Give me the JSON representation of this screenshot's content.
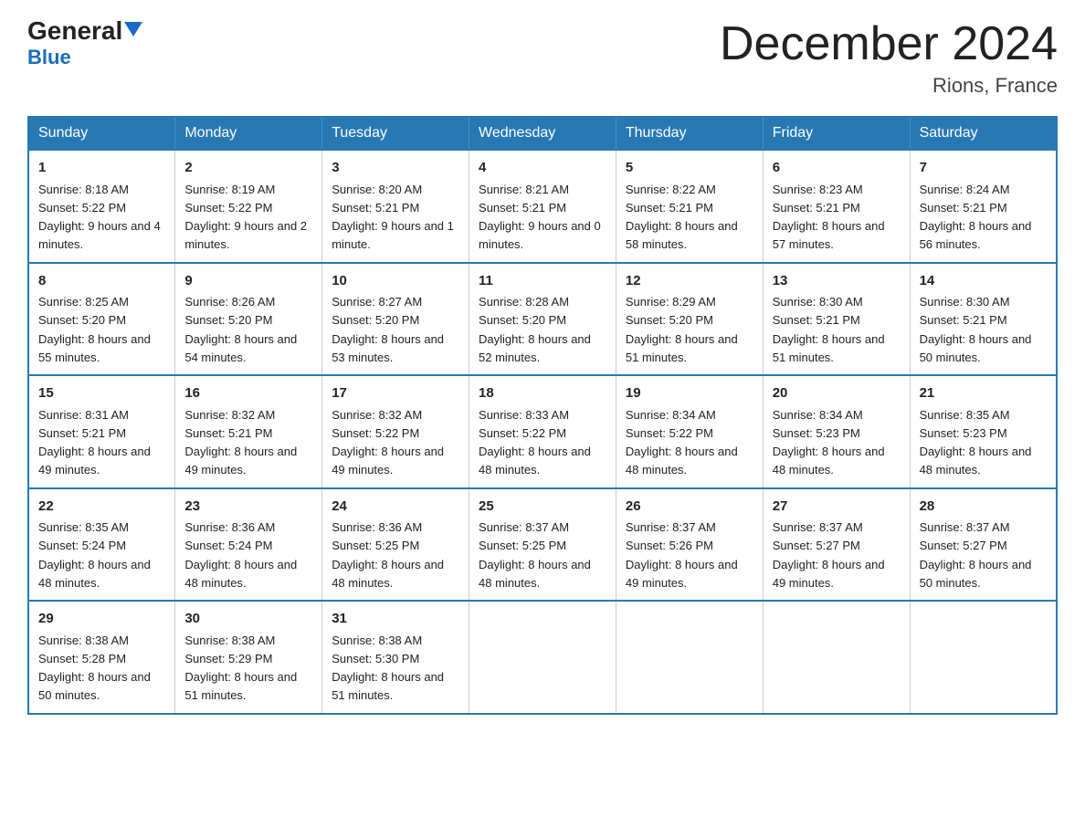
{
  "logo": {
    "general": "General",
    "blue": "Blue"
  },
  "title": "December 2024",
  "location": "Rions, France",
  "days_of_week": [
    "Sunday",
    "Monday",
    "Tuesday",
    "Wednesday",
    "Thursday",
    "Friday",
    "Saturday"
  ],
  "weeks": [
    [
      {
        "day": "1",
        "sunrise": "8:18 AM",
        "sunset": "5:22 PM",
        "daylight": "9 hours and 4 minutes."
      },
      {
        "day": "2",
        "sunrise": "8:19 AM",
        "sunset": "5:22 PM",
        "daylight": "9 hours and 2 minutes."
      },
      {
        "day": "3",
        "sunrise": "8:20 AM",
        "sunset": "5:21 PM",
        "daylight": "9 hours and 1 minute."
      },
      {
        "day": "4",
        "sunrise": "8:21 AM",
        "sunset": "5:21 PM",
        "daylight": "9 hours and 0 minutes."
      },
      {
        "day": "5",
        "sunrise": "8:22 AM",
        "sunset": "5:21 PM",
        "daylight": "8 hours and 58 minutes."
      },
      {
        "day": "6",
        "sunrise": "8:23 AM",
        "sunset": "5:21 PM",
        "daylight": "8 hours and 57 minutes."
      },
      {
        "day": "7",
        "sunrise": "8:24 AM",
        "sunset": "5:21 PM",
        "daylight": "8 hours and 56 minutes."
      }
    ],
    [
      {
        "day": "8",
        "sunrise": "8:25 AM",
        "sunset": "5:20 PM",
        "daylight": "8 hours and 55 minutes."
      },
      {
        "day": "9",
        "sunrise": "8:26 AM",
        "sunset": "5:20 PM",
        "daylight": "8 hours and 54 minutes."
      },
      {
        "day": "10",
        "sunrise": "8:27 AM",
        "sunset": "5:20 PM",
        "daylight": "8 hours and 53 minutes."
      },
      {
        "day": "11",
        "sunrise": "8:28 AM",
        "sunset": "5:20 PM",
        "daylight": "8 hours and 52 minutes."
      },
      {
        "day": "12",
        "sunrise": "8:29 AM",
        "sunset": "5:20 PM",
        "daylight": "8 hours and 51 minutes."
      },
      {
        "day": "13",
        "sunrise": "8:30 AM",
        "sunset": "5:21 PM",
        "daylight": "8 hours and 51 minutes."
      },
      {
        "day": "14",
        "sunrise": "8:30 AM",
        "sunset": "5:21 PM",
        "daylight": "8 hours and 50 minutes."
      }
    ],
    [
      {
        "day": "15",
        "sunrise": "8:31 AM",
        "sunset": "5:21 PM",
        "daylight": "8 hours and 49 minutes."
      },
      {
        "day": "16",
        "sunrise": "8:32 AM",
        "sunset": "5:21 PM",
        "daylight": "8 hours and 49 minutes."
      },
      {
        "day": "17",
        "sunrise": "8:32 AM",
        "sunset": "5:22 PM",
        "daylight": "8 hours and 49 minutes."
      },
      {
        "day": "18",
        "sunrise": "8:33 AM",
        "sunset": "5:22 PM",
        "daylight": "8 hours and 48 minutes."
      },
      {
        "day": "19",
        "sunrise": "8:34 AM",
        "sunset": "5:22 PM",
        "daylight": "8 hours and 48 minutes."
      },
      {
        "day": "20",
        "sunrise": "8:34 AM",
        "sunset": "5:23 PM",
        "daylight": "8 hours and 48 minutes."
      },
      {
        "day": "21",
        "sunrise": "8:35 AM",
        "sunset": "5:23 PM",
        "daylight": "8 hours and 48 minutes."
      }
    ],
    [
      {
        "day": "22",
        "sunrise": "8:35 AM",
        "sunset": "5:24 PM",
        "daylight": "8 hours and 48 minutes."
      },
      {
        "day": "23",
        "sunrise": "8:36 AM",
        "sunset": "5:24 PM",
        "daylight": "8 hours and 48 minutes."
      },
      {
        "day": "24",
        "sunrise": "8:36 AM",
        "sunset": "5:25 PM",
        "daylight": "8 hours and 48 minutes."
      },
      {
        "day": "25",
        "sunrise": "8:37 AM",
        "sunset": "5:25 PM",
        "daylight": "8 hours and 48 minutes."
      },
      {
        "day": "26",
        "sunrise": "8:37 AM",
        "sunset": "5:26 PM",
        "daylight": "8 hours and 49 minutes."
      },
      {
        "day": "27",
        "sunrise": "8:37 AM",
        "sunset": "5:27 PM",
        "daylight": "8 hours and 49 minutes."
      },
      {
        "day": "28",
        "sunrise": "8:37 AM",
        "sunset": "5:27 PM",
        "daylight": "8 hours and 50 minutes."
      }
    ],
    [
      {
        "day": "29",
        "sunrise": "8:38 AM",
        "sunset": "5:28 PM",
        "daylight": "8 hours and 50 minutes."
      },
      {
        "day": "30",
        "sunrise": "8:38 AM",
        "sunset": "5:29 PM",
        "daylight": "8 hours and 51 minutes."
      },
      {
        "day": "31",
        "sunrise": "8:38 AM",
        "sunset": "5:30 PM",
        "daylight": "8 hours and 51 minutes."
      },
      null,
      null,
      null,
      null
    ]
  ]
}
